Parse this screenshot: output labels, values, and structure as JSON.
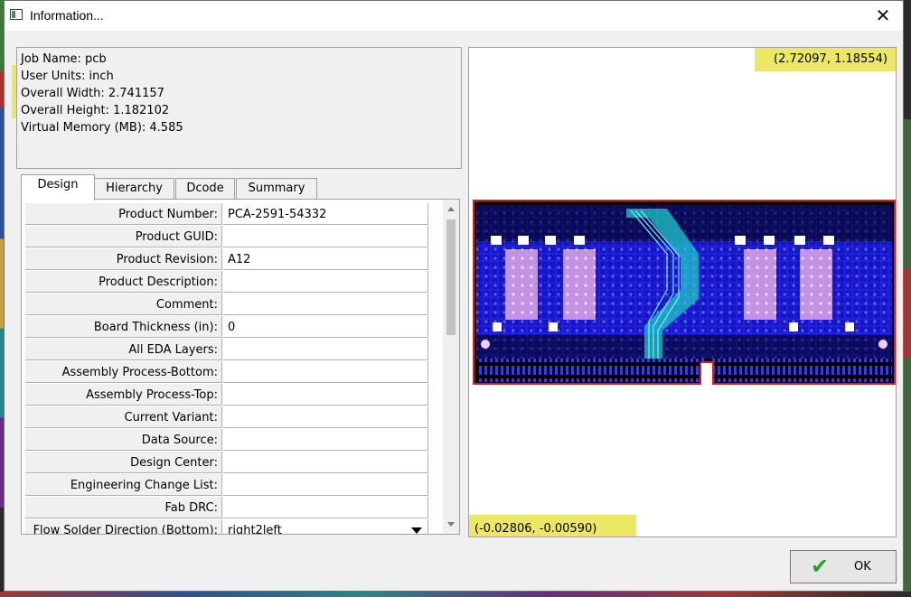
{
  "window": {
    "title": "Information...",
    "close_glyph": "✕"
  },
  "info": {
    "job_name": "Job Name: pcb",
    "user_units": "User Units: inch",
    "overall_width": "Overall Width: 2.741157",
    "overall_height": "Overall Height: 1.182102",
    "virtual_memory": "Virtual Memory (MB): 4.585"
  },
  "tabs": [
    {
      "label": "Design",
      "active": true
    },
    {
      "label": "Hierarchy",
      "active": false
    },
    {
      "label": "Dcode",
      "active": false
    },
    {
      "label": "Summary",
      "active": false
    }
  ],
  "design_rows": [
    {
      "label": "Product Number:",
      "value": "PCA-2591-54332"
    },
    {
      "label": "Product GUID:",
      "value": ""
    },
    {
      "label": "Product Revision:",
      "value": "A12"
    },
    {
      "label": "Product Description:",
      "value": ""
    },
    {
      "label": "Comment:",
      "value": ""
    },
    {
      "label": "Board Thickness (in):",
      "value": "0"
    },
    {
      "label": "All EDA Layers:",
      "value": ""
    },
    {
      "label": "Assembly Process-Bottom:",
      "value": ""
    },
    {
      "label": "Assembly Process-Top:",
      "value": ""
    },
    {
      "label": "Current Variant:",
      "value": ""
    },
    {
      "label": "Data Source:",
      "value": ""
    },
    {
      "label": "Design Center:",
      "value": ""
    },
    {
      "label": "Engineering Change List:",
      "value": ""
    },
    {
      "label": "Fab DRC:",
      "value": ""
    },
    {
      "label": "Flow Solder Direction (Bottom):",
      "value": "right2left"
    }
  ],
  "preview": {
    "top_right_coord": "(2.72097, 1.18554)",
    "bottom_left_coord": "(-0.02806, -0.00590)"
  },
  "buttons": {
    "ok_label": "OK",
    "ok_icon": "checkmark-icon"
  },
  "colors": {
    "highlight": "#e9e34a",
    "board_outline": "#d62020",
    "board_copper": "#1a1ad0",
    "ok_check": "#2aa02a"
  }
}
